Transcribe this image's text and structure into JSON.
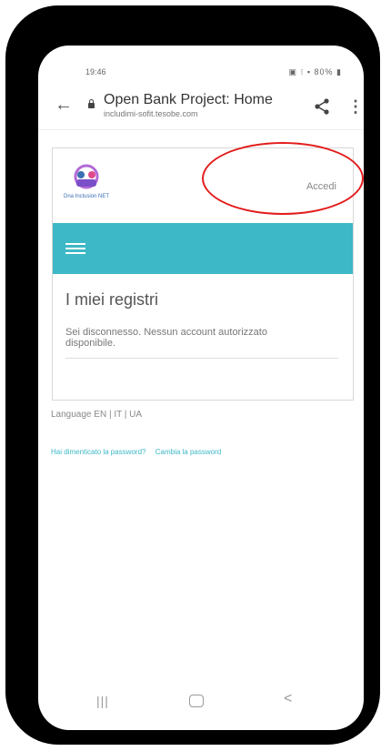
{
  "status_bar": {
    "time": "19:46",
    "icons": "▣ ⁝ ▪ 80% ▮"
  },
  "browser": {
    "title": "Open Bank Project: Home",
    "url": "includimi-sofit.tesobe.com"
  },
  "site": {
    "logo_text": "Dna Inclusion NET",
    "login_label": "Accedi",
    "section_title": "I miei registri",
    "message": "Sei disconnesso. Nessun account autorizzato disponibile.",
    "language": "Language EN | IT | UA",
    "forgot_password": "Hai dimenticato la password?",
    "change_password": "Cambia la password"
  },
  "nav": {
    "recent": "|||",
    "back": "<"
  },
  "colors": {
    "accent": "#3cb8c6",
    "annotation": "#e31b1b"
  }
}
